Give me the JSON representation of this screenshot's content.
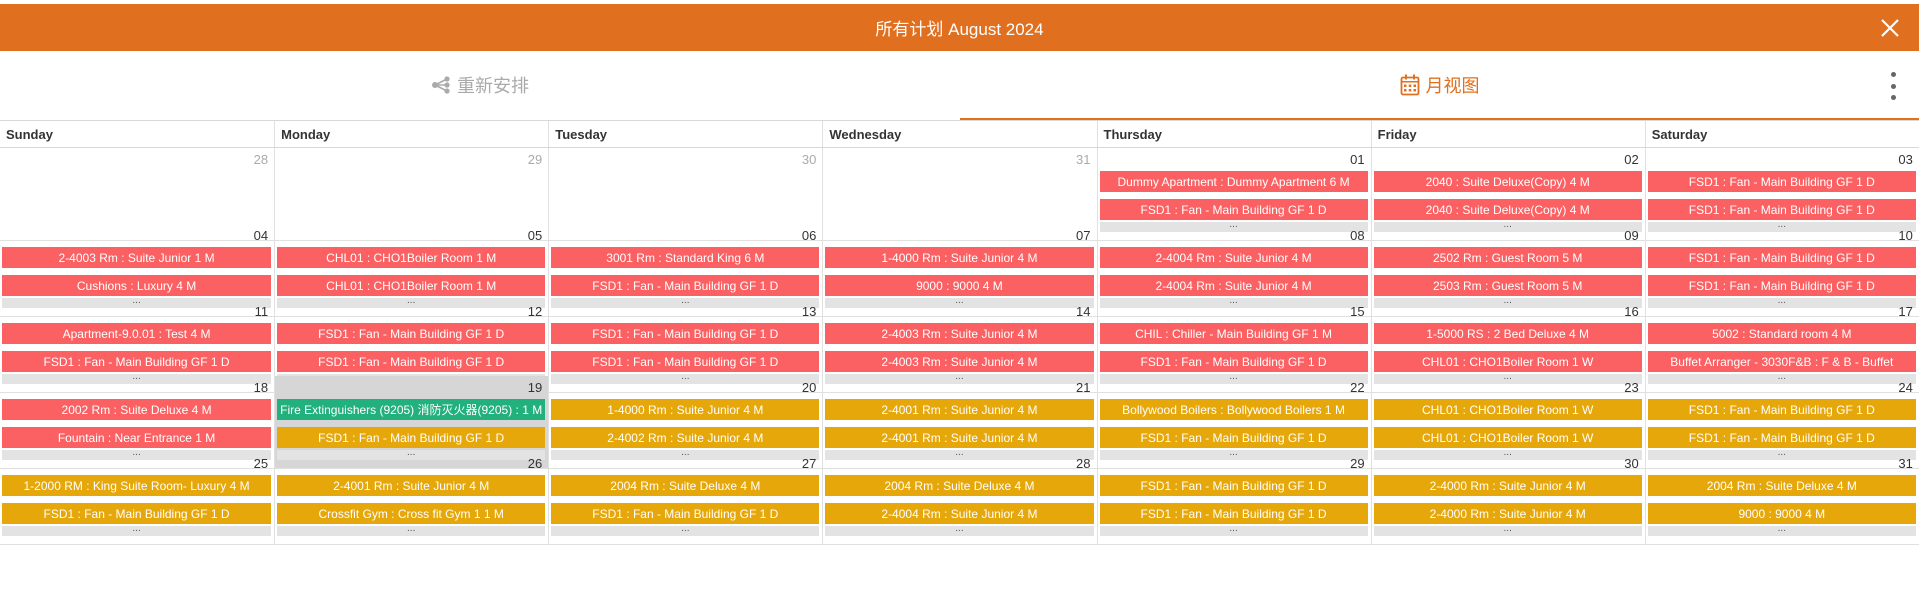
{
  "header": {
    "title": "所有计划 August 2024",
    "close_icon": "close-icon"
  },
  "tabs": [
    {
      "label": "重新安排",
      "icon": "share-network-icon"
    },
    {
      "label": "月视图",
      "icon": "calendar-icon"
    }
  ],
  "more_icon": "more-vertical-icon",
  "colors": {
    "header": "#e07020",
    "overdue": "#fb6063",
    "done": "#22b07d",
    "upcoming": "#e6a70a"
  },
  "weekdays": [
    "Sunday",
    "Monday",
    "Tuesday",
    "Wednesday",
    "Thursday",
    "Friday",
    "Saturday"
  ],
  "more_label": "...",
  "weeks": [
    [
      {
        "num": "28",
        "other": true,
        "events": []
      },
      {
        "num": "29",
        "other": true,
        "events": []
      },
      {
        "num": "30",
        "other": true,
        "events": []
      },
      {
        "num": "31",
        "other": true,
        "events": []
      },
      {
        "num": "01",
        "events": [
          {
            "t": "Dummy Apartment : Dummy Apartment 6 M",
            "c": "red"
          },
          {
            "t": "FSD1 : Fan - Main Building GF 1 D",
            "c": "red"
          }
        ],
        "more": true
      },
      {
        "num": "02",
        "events": [
          {
            "t": "2040 : Suite Deluxe(Copy) 4 M",
            "c": "red"
          },
          {
            "t": "2040 : Suite Deluxe(Copy) 4 M",
            "c": "red"
          }
        ],
        "more": true
      },
      {
        "num": "03",
        "events": [
          {
            "t": "FSD1 : Fan - Main Building GF 1 D",
            "c": "red"
          },
          {
            "t": "FSD1 : Fan - Main Building GF 1 D",
            "c": "red"
          }
        ],
        "more": true
      }
    ],
    [
      {
        "num": "04",
        "events": [
          {
            "t": "2-4003 Rm : Suite Junior 1 M",
            "c": "red"
          },
          {
            "t": "Cushions : Luxury 4 M",
            "c": "red"
          }
        ],
        "more": true
      },
      {
        "num": "05",
        "events": [
          {
            "t": "CHL01 : CHO1Boiler Room 1 M",
            "c": "red"
          },
          {
            "t": "CHL01 : CHO1Boiler Room 1 M",
            "c": "red"
          }
        ],
        "more": true
      },
      {
        "num": "06",
        "events": [
          {
            "t": "3001 Rm : Standard King 6 M",
            "c": "red"
          },
          {
            "t": "FSD1 : Fan - Main Building GF 1 D",
            "c": "red"
          }
        ],
        "more": true
      },
      {
        "num": "07",
        "events": [
          {
            "t": "1-4000 Rm : Suite Junior 4 M",
            "c": "red"
          },
          {
            "t": "9000 : 9000 4 M",
            "c": "red"
          }
        ],
        "more": true
      },
      {
        "num": "08",
        "events": [
          {
            "t": "2-4004 Rm : Suite Junior 4 M",
            "c": "red"
          },
          {
            "t": "2-4004 Rm : Suite Junior 4 M",
            "c": "red"
          }
        ],
        "more": true
      },
      {
        "num": "09",
        "events": [
          {
            "t": "2502 Rm : Guest Room 5 M",
            "c": "red"
          },
          {
            "t": "2503 Rm : Guest Room 5 M",
            "c": "red"
          }
        ],
        "more": true
      },
      {
        "num": "10",
        "events": [
          {
            "t": "FSD1 : Fan - Main Building GF 1 D",
            "c": "red"
          },
          {
            "t": "FSD1 : Fan - Main Building GF 1 D",
            "c": "red"
          }
        ],
        "more": true
      }
    ],
    [
      {
        "num": "11",
        "events": [
          {
            "t": "Apartment-9.0.01 : Test 4 M",
            "c": "red"
          },
          {
            "t": "FSD1 : Fan - Main Building GF 1 D",
            "c": "red"
          }
        ],
        "more": true
      },
      {
        "num": "12",
        "events": [
          {
            "t": "FSD1 : Fan - Main Building GF 1 D",
            "c": "red"
          },
          {
            "t": "FSD1 : Fan - Main Building GF 1 D",
            "c": "red"
          }
        ],
        "more": true
      },
      {
        "num": "13",
        "events": [
          {
            "t": "FSD1 : Fan - Main Building GF 1 D",
            "c": "red"
          },
          {
            "t": "FSD1 : Fan - Main Building GF 1 D",
            "c": "red"
          }
        ],
        "more": true
      },
      {
        "num": "14",
        "events": [
          {
            "t": "2-4003 Rm : Suite Junior 4 M",
            "c": "red"
          },
          {
            "t": "2-4003 Rm : Suite Junior 4 M",
            "c": "red"
          }
        ],
        "more": true
      },
      {
        "num": "15",
        "events": [
          {
            "t": "CHIL : Chiller - Main Building GF 1 M",
            "c": "red"
          },
          {
            "t": "FSD1 : Fan - Main Building GF 1 D",
            "c": "red"
          }
        ],
        "more": true
      },
      {
        "num": "16",
        "events": [
          {
            "t": "1-5000 RS : 2 Bed Deluxe 4 M",
            "c": "red"
          },
          {
            "t": "CHL01 : CHO1Boiler Room 1 W",
            "c": "red"
          }
        ],
        "more": true
      },
      {
        "num": "17",
        "events": [
          {
            "t": "5002 : Standard room 4 M",
            "c": "red"
          },
          {
            "t": "Buffet Arranger - 3030F&B : F & B - Buffet",
            "c": "red"
          }
        ],
        "more": true
      }
    ],
    [
      {
        "num": "18",
        "events": [
          {
            "t": "2002 Rm : Suite Deluxe 4 M",
            "c": "red"
          },
          {
            "t": "Fountain : Near Entrance 1 M",
            "c": "red"
          }
        ],
        "more": true
      },
      {
        "num": "19",
        "today": true,
        "events": [
          {
            "t": "Fire Extinguishers (9205) 消防灭火器(9205) : 1 M",
            "c": "green"
          },
          {
            "t": "FSD1 : Fan - Main Building GF 1 D",
            "c": "yellow"
          }
        ],
        "more": true
      },
      {
        "num": "20",
        "events": [
          {
            "t": "1-4000 Rm : Suite Junior 4 M",
            "c": "yellow"
          },
          {
            "t": "2-4002 Rm : Suite Junior 4 M",
            "c": "yellow"
          }
        ],
        "more": true
      },
      {
        "num": "21",
        "events": [
          {
            "t": "2-4001 Rm : Suite Junior 4 M",
            "c": "yellow"
          },
          {
            "t": "2-4001 Rm : Suite Junior 4 M",
            "c": "yellow"
          }
        ],
        "more": true
      },
      {
        "num": "22",
        "events": [
          {
            "t": "Bollywood Boilers : Bollywood Boilers 1 M",
            "c": "yellow"
          },
          {
            "t": "FSD1 : Fan - Main Building GF 1 D",
            "c": "yellow"
          }
        ],
        "more": true
      },
      {
        "num": "23",
        "events": [
          {
            "t": "CHL01 : CHO1Boiler Room 1 W",
            "c": "yellow"
          },
          {
            "t": "CHL01 : CHO1Boiler Room 1 W",
            "c": "yellow"
          }
        ],
        "more": true
      },
      {
        "num": "24",
        "events": [
          {
            "t": "FSD1 : Fan - Main Building GF 1 D",
            "c": "yellow"
          },
          {
            "t": "FSD1 : Fan - Main Building GF 1 D",
            "c": "yellow"
          }
        ],
        "more": true
      }
    ],
    [
      {
        "num": "25",
        "events": [
          {
            "t": "1-2000 RM : King Suite Room- Luxury 4 M",
            "c": "yellow"
          },
          {
            "t": "FSD1 : Fan - Main Building GF 1 D",
            "c": "yellow"
          }
        ],
        "more": true
      },
      {
        "num": "26",
        "events": [
          {
            "t": "2-4001 Rm : Suite Junior 4 M",
            "c": "yellow"
          },
          {
            "t": "Crossfit Gym : Cross fit Gym 1 1 M",
            "c": "yellow"
          }
        ],
        "more": true
      },
      {
        "num": "27",
        "events": [
          {
            "t": "2004 Rm : Suite Deluxe 4 M",
            "c": "yellow"
          },
          {
            "t": "FSD1 : Fan - Main Building GF 1 D",
            "c": "yellow"
          }
        ],
        "more": true
      },
      {
        "num": "28",
        "events": [
          {
            "t": "2004 Rm : Suite Deluxe 4 M",
            "c": "yellow"
          },
          {
            "t": "2-4004 Rm : Suite Junior 4 M",
            "c": "yellow"
          }
        ],
        "more": true
      },
      {
        "num": "29",
        "events": [
          {
            "t": "FSD1 : Fan - Main Building GF 1 D",
            "c": "yellow"
          },
          {
            "t": "FSD1 : Fan - Main Building GF 1 D",
            "c": "yellow"
          }
        ],
        "more": true
      },
      {
        "num": "30",
        "events": [
          {
            "t": "2-4000 Rm : Suite Junior 4 M",
            "c": "yellow"
          },
          {
            "t": "2-4000 Rm : Suite Junior 4 M",
            "c": "yellow"
          }
        ],
        "more": true
      },
      {
        "num": "31",
        "events": [
          {
            "t": "2004 Rm : Suite Deluxe 4 M",
            "c": "yellow"
          },
          {
            "t": "9000 : 9000 4 M",
            "c": "yellow"
          }
        ],
        "more": true
      }
    ]
  ]
}
